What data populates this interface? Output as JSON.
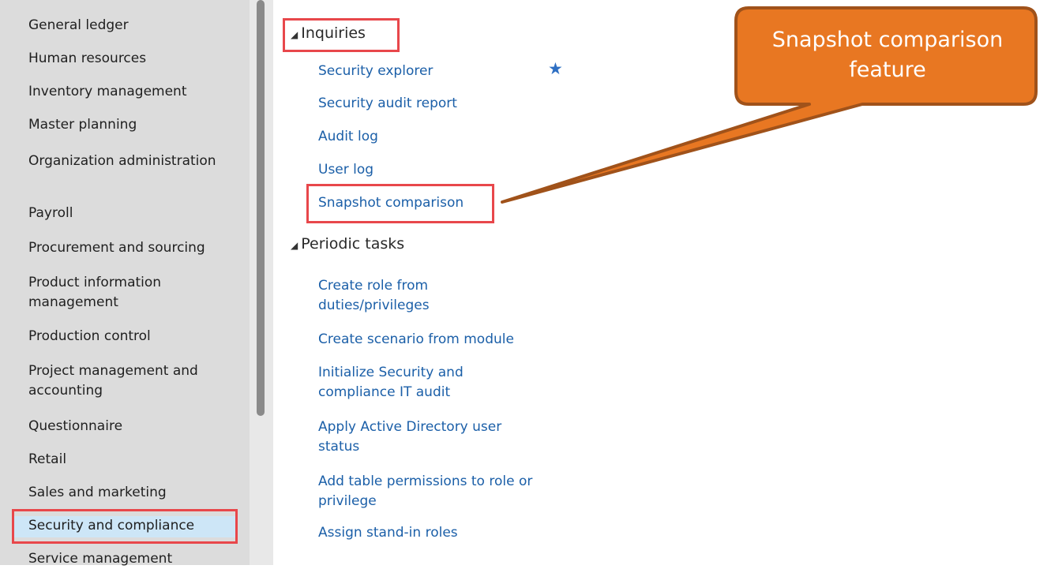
{
  "sidebar": {
    "items": [
      {
        "label": "General ledger"
      },
      {
        "label": "Human resources"
      },
      {
        "label": "Inventory management"
      },
      {
        "label": "Master planning"
      },
      {
        "label": "Organization administration"
      },
      {
        "label": "Payroll"
      },
      {
        "label": "Procurement and sourcing"
      },
      {
        "label": "Product information management"
      },
      {
        "label": "Production control"
      },
      {
        "label": "Project management and accounting"
      },
      {
        "label": "Questionnaire"
      },
      {
        "label": "Retail"
      },
      {
        "label": "Sales and marketing"
      },
      {
        "label": "Security and compliance"
      },
      {
        "label": "Service management"
      }
    ],
    "selected": "Security and compliance"
  },
  "menu": {
    "inquiries": {
      "header": "Inquiries",
      "links": [
        {
          "label": "Security explorer",
          "favorite": true
        },
        {
          "label": "Security audit report"
        },
        {
          "label": "Audit log"
        },
        {
          "label": "User log"
        },
        {
          "label": "Snapshot comparison"
        }
      ]
    },
    "periodic_tasks": {
      "header": "Periodic tasks",
      "links": [
        {
          "label": "Create role from duties/privileges"
        },
        {
          "label": "Create scenario from module"
        },
        {
          "label": "Initialize Security and compliance IT audit"
        },
        {
          "label": "Apply Active Directory user status"
        },
        {
          "label": "Add table permissions to role or privilege"
        },
        {
          "label": "Assign stand-in roles"
        }
      ]
    }
  },
  "callout": {
    "text": "Snapshot comparison feature",
    "fill_color": "#e87722",
    "border_color": "#a0521a"
  },
  "colors": {
    "highlight_border": "#e8474b",
    "link": "#1b5fa8",
    "selected_bg": "#cde6f7"
  },
  "icons": {
    "favorite": "star-icon",
    "expand": "triangle-collapse-icon"
  }
}
